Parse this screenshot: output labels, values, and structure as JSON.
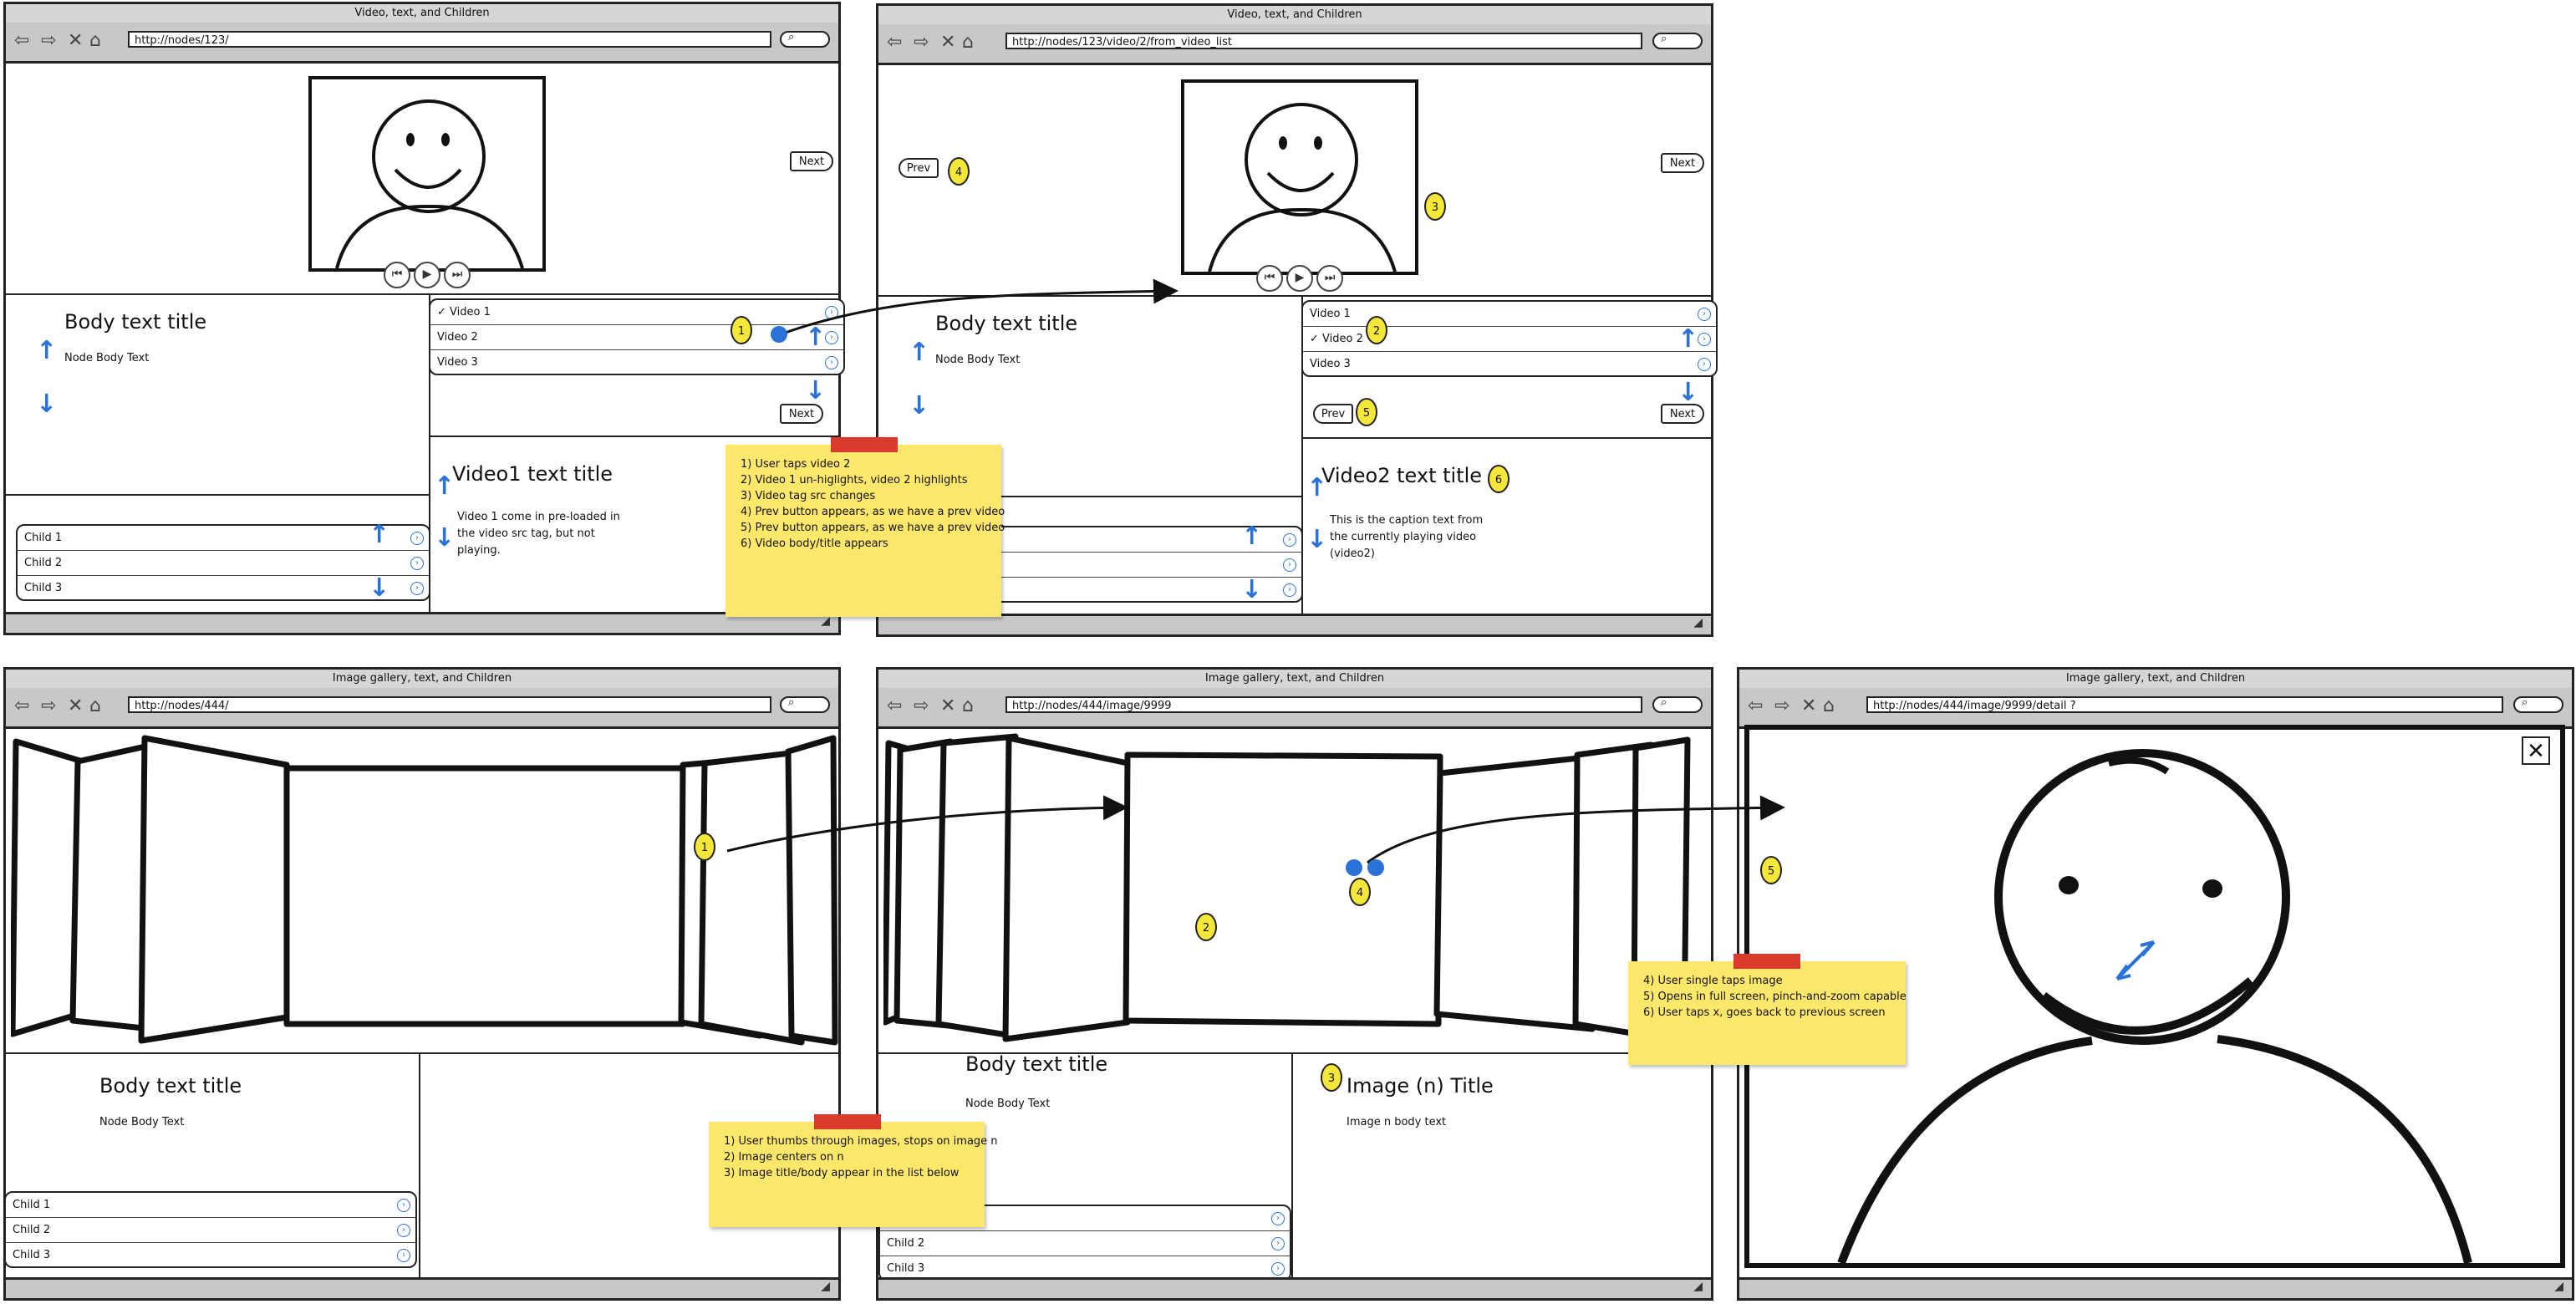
{
  "screens": {
    "video_list": {
      "title": "Video, text, and Children",
      "url": "http://nodes/123/",
      "next_label": "Next",
      "body_title": "Body text title",
      "body_text": "Node Body Text",
      "videos": [
        "Video 1",
        "Video 2",
        "Video 3"
      ],
      "video_checked": "✓",
      "video_text_title": "Video1 text title",
      "video_text_body": [
        "Video 1 come in pre-loaded in",
        "the video src tag, but not",
        "playing."
      ],
      "children": [
        "Child 1",
        "Child 2",
        "Child 3"
      ]
    },
    "video_detail": {
      "title": "Video, text, and Children",
      "url": "http://nodes/123/video/2/from_video_list",
      "prev_label": "Prev",
      "next_label": "Next",
      "body_title": "Body text title",
      "body_text": "Node Body Text",
      "videos": [
        "Video 1",
        "Video 2",
        "Video 3"
      ],
      "video_checked": "✓",
      "video_text_title": "Video2 text title",
      "video_text_body": [
        "This is the caption text from",
        "the currently playing video",
        "(video2)"
      ]
    },
    "gallery": {
      "title": "Image gallery, text, and Children",
      "url": "http://nodes/444/",
      "body_title": "Body text title",
      "body_text": "Node Body Text",
      "children": [
        "Child 1",
        "Child 2",
        "Child 3"
      ]
    },
    "gallery_image": {
      "title": "Image gallery, text, and Children",
      "url": "http://nodes/444/image/9999",
      "body_title": "Body text title",
      "body_text": "Node Body Text",
      "image_title": "Image (n) Title",
      "image_text": "Image n body text",
      "children": [
        "Child 2",
        "Child 3"
      ]
    },
    "image_detail": {
      "title": "Image gallery, text, and Children",
      "url": "http://nodes/444/image/9999/detail ?",
      "close_label": "✕"
    }
  },
  "badges": {
    "b1": "1",
    "b2": "2",
    "b3": "3",
    "b4": "4",
    "b5": "5",
    "b6": "6",
    "g1": "1",
    "g2": "2",
    "g3": "3",
    "g4": "4",
    "g5": "5"
  },
  "notes": {
    "video_steps": [
      "1) User taps video 2",
      "2) Video 1 un-higlights, video 2 highlights",
      "3) Video tag src changes",
      "4) Prev button appears, as we have a prev video",
      "5) Prev button appears, as we have a prev video",
      "6) Video body/title appears"
    ],
    "gallery_steps": [
      "1) User thumbs through images, stops on image n",
      "2) Image centers on n",
      "3) Image title/body appear in the list below"
    ],
    "detail_steps": [
      "4) User single taps image",
      "5) Opens in full screen, pinch-and-zoom capable",
      "6) User taps x, goes back to previous screen"
    ]
  },
  "icons": {
    "back": "⇦",
    "forward": "⇨",
    "stop": "✕",
    "home": "⌂",
    "search": "⌕",
    "chevron": "›",
    "up": "↑",
    "down": "↓",
    "rewind": "⏮",
    "play": "▶",
    "ffwd": "⏭",
    "resize": "◢"
  },
  "colors": {
    "accent_blue": "#2b72d8",
    "sticky_yellow": "#fde86c",
    "badge_yellow": "#f5e63a",
    "tape_red": "#d93a2b"
  }
}
